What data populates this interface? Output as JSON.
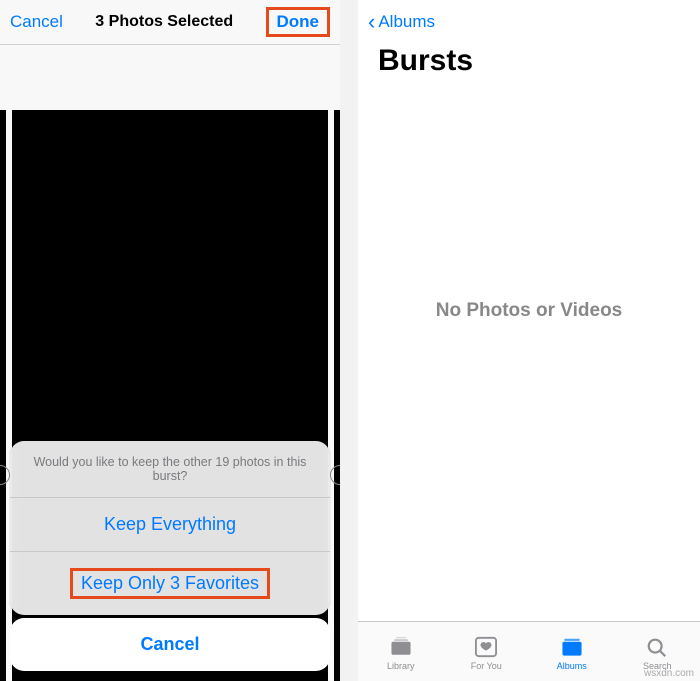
{
  "left": {
    "topbar": {
      "cancel": "Cancel",
      "title": "3 Photos Selected",
      "done": "Done"
    },
    "sheet": {
      "prompt": "Would you like to keep the other 19 photos in this burst?",
      "keep_all": "Keep Everything",
      "keep_fav": "Keep Only 3 Favorites",
      "cancel": "Cancel"
    }
  },
  "right": {
    "back_label": "Albums",
    "page_title": "Bursts",
    "empty_message": "No Photos or Videos",
    "tabs": {
      "library": "Library",
      "foryou": "For You",
      "albums": "Albums",
      "search": "Search"
    }
  },
  "watermark": "wsxdn.com"
}
